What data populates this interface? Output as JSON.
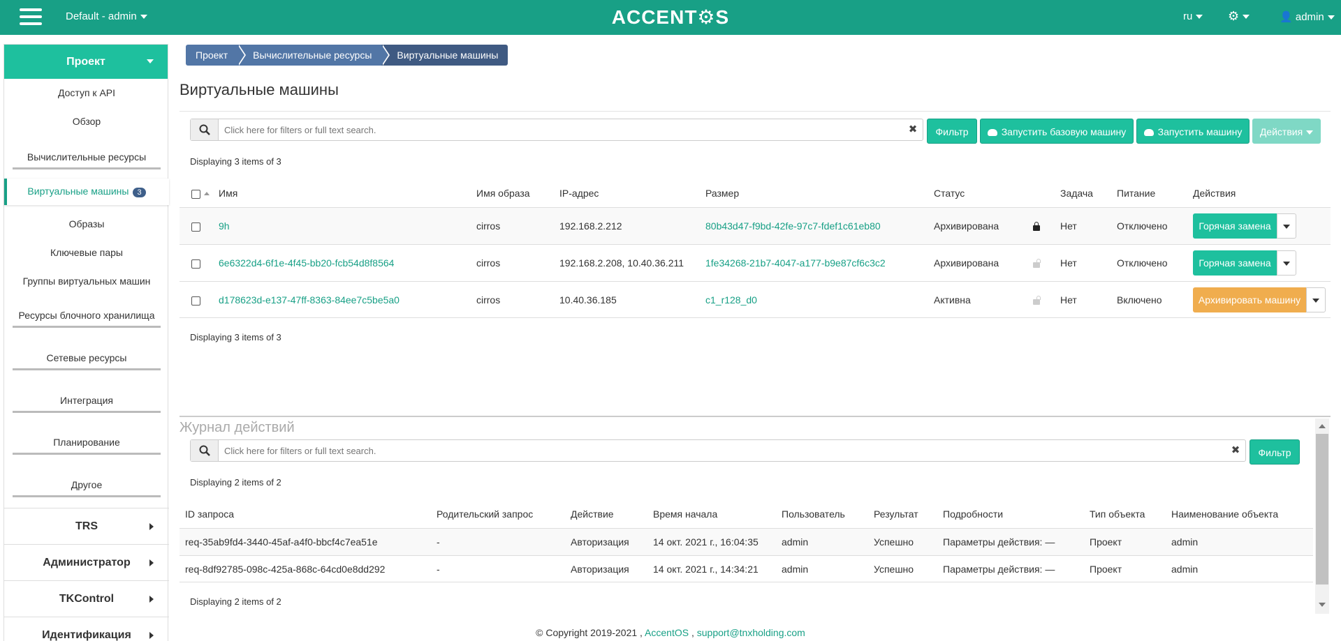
{
  "topbar": {
    "project": "Default - admin",
    "logo": "ACCENT⚙S",
    "lang": "ru",
    "user": "admin"
  },
  "sidebar": {
    "header": "Проект",
    "items": [
      {
        "label": "Доступ к API"
      },
      {
        "label": "Обзор"
      },
      {
        "label": "Вычислительные ресурсы"
      },
      {
        "label": "Виртуальные машины",
        "badge": "3"
      },
      {
        "label": "Образы"
      },
      {
        "label": "Ключевые пары"
      },
      {
        "label": "Группы виртуальных машин"
      },
      {
        "label": "Ресурсы блочного хранилища"
      },
      {
        "label": "Сетевые ресурсы"
      },
      {
        "label": "Интеграция"
      },
      {
        "label": "Планирование"
      },
      {
        "label": "Другое"
      }
    ],
    "groups": [
      "TRS",
      "Администратор",
      "TKControl",
      "Идентификация"
    ]
  },
  "breadcrumb": [
    "Проект",
    "Вычислительные ресурсы",
    "Виртуальные машины"
  ],
  "page_title": "Виртуальные машины",
  "search": {
    "placeholder": "Click here for filters or full text search."
  },
  "toolbar": {
    "filter": "Фильтр",
    "launch_base": "Запустить базовую машину",
    "launch": "Запустить машину",
    "actions": "Действия"
  },
  "vm_count": "Displaying 3 items of 3",
  "vm_table": {
    "headers": [
      "Имя",
      "Имя образа",
      "IP-адрес",
      "Размер",
      "Статус",
      "Задача",
      "Питание",
      "Действия"
    ],
    "rows": [
      {
        "name": "9h",
        "image": "cirros",
        "ip": "192.168.2.212",
        "size": "80b43d47-f9bd-42fe-97c7-fdef1c61eb80",
        "status": "Архивирована",
        "locked": true,
        "task": "Нет",
        "power": "Отключено",
        "action": "Горячая замена"
      },
      {
        "name": "6e6322d4-6f1e-4f45-bb20-fcb54d8f8564",
        "image": "cirros",
        "ip": "192.168.2.208, 10.40.36.211",
        "size": "1fe34268-21b7-4047-a177-b9e87cf6c3c2",
        "status": "Архивирована",
        "locked": false,
        "task": "Нет",
        "power": "Отключено",
        "action": "Горячая замена"
      },
      {
        "name": "d178623d-e137-47ff-8363-84ee7c5be5a0",
        "image": "cirros",
        "ip": "10.40.36.185",
        "size": "c1_r128_d0",
        "status": "Активна",
        "locked": false,
        "task": "Нет",
        "power": "Включено",
        "action": "Архивировать машину"
      }
    ]
  },
  "log": {
    "title": "Журнал действий",
    "filter": "Фильтр",
    "count": "Displaying 2 items of 2",
    "headers": [
      "ID запроса",
      "Родительский запрос",
      "Действие",
      "Время начала",
      "Пользователь",
      "Результат",
      "Подробности",
      "Тип объекта",
      "Наименование объекта"
    ],
    "rows": [
      [
        "req-35ab9fd4-3440-45af-a4f0-bbcf4c7ea51e",
        "-",
        "Авторизация",
        "14 окт. 2021 г., 16:04:35",
        "admin",
        "Успешно",
        "Параметры действия: —",
        "Проект",
        "admin"
      ],
      [
        "req-8df92785-098c-425a-868c-64cd0e8dd292",
        "-",
        "Авторизация",
        "14 окт. 2021 г., 14:34:21",
        "admin",
        "Успешно",
        "Параметры действия: —",
        "Проект",
        "admin"
      ]
    ]
  },
  "footer": {
    "copyright": "© Copyright 2019-2021 ,",
    "brand": "AccentOS",
    "sep": ",",
    "email": "support@tnxholding.com"
  },
  "colors": {
    "primary": "#18a086",
    "button": "#1ec09e",
    "warning": "#f0ad4e",
    "breadcrumb": "#5276a6"
  }
}
